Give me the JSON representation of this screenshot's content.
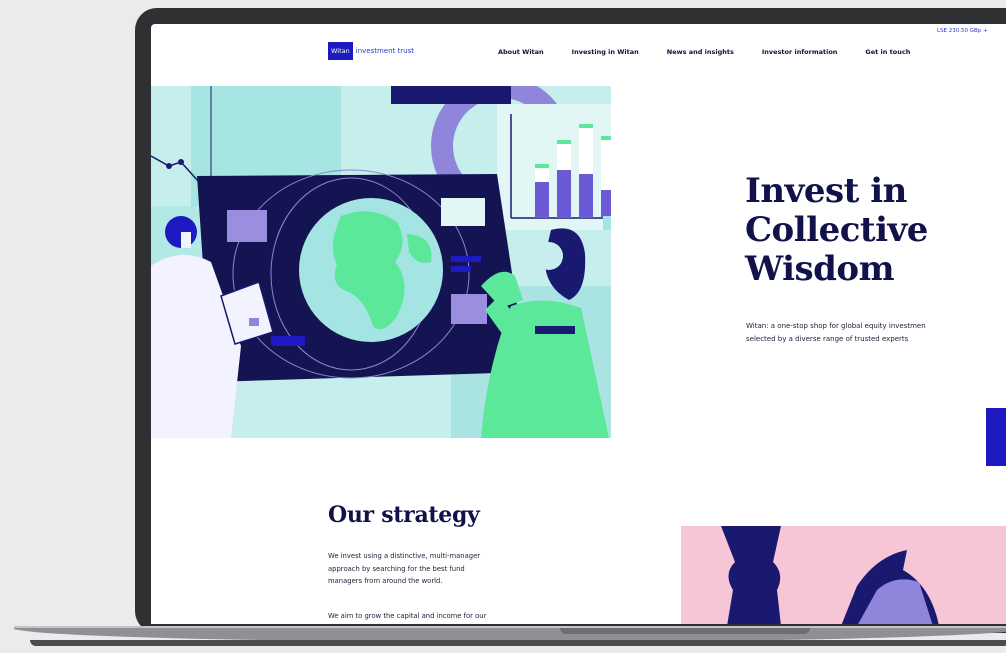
{
  "header": {
    "ticker": "LSE 230.50 GBp +",
    "logo_mark": "Witan",
    "logo_text": "investment trust",
    "nav": [
      {
        "label": "About Witan"
      },
      {
        "label": "Investing in Witan"
      },
      {
        "label": "News and insights"
      },
      {
        "label": "Investor information"
      },
      {
        "label": "Get in touch"
      }
    ]
  },
  "hero": {
    "title_lines": [
      "Invest in",
      "Collective",
      "Wisdom"
    ],
    "subtitle_lines": [
      "Witan: a one-stop shop for global equity investmen",
      "selected by a diverse range of trusted experts"
    ]
  },
  "strategy": {
    "title": "Our strategy",
    "paragraph1_lines": [
      "We invest using a distinctive, multi-manager",
      "approach by searching for the best fund",
      "managers from around the world."
    ],
    "paragraph2": "We aim to grow the capital and income for our"
  },
  "colors": {
    "brand_blue": "#1d1ac2",
    "navy": "#11124a",
    "mint": "#5ce89a",
    "aqua": "#bff0ee",
    "lavender": "#9b8ee0",
    "pink": "#f6c6d6"
  }
}
